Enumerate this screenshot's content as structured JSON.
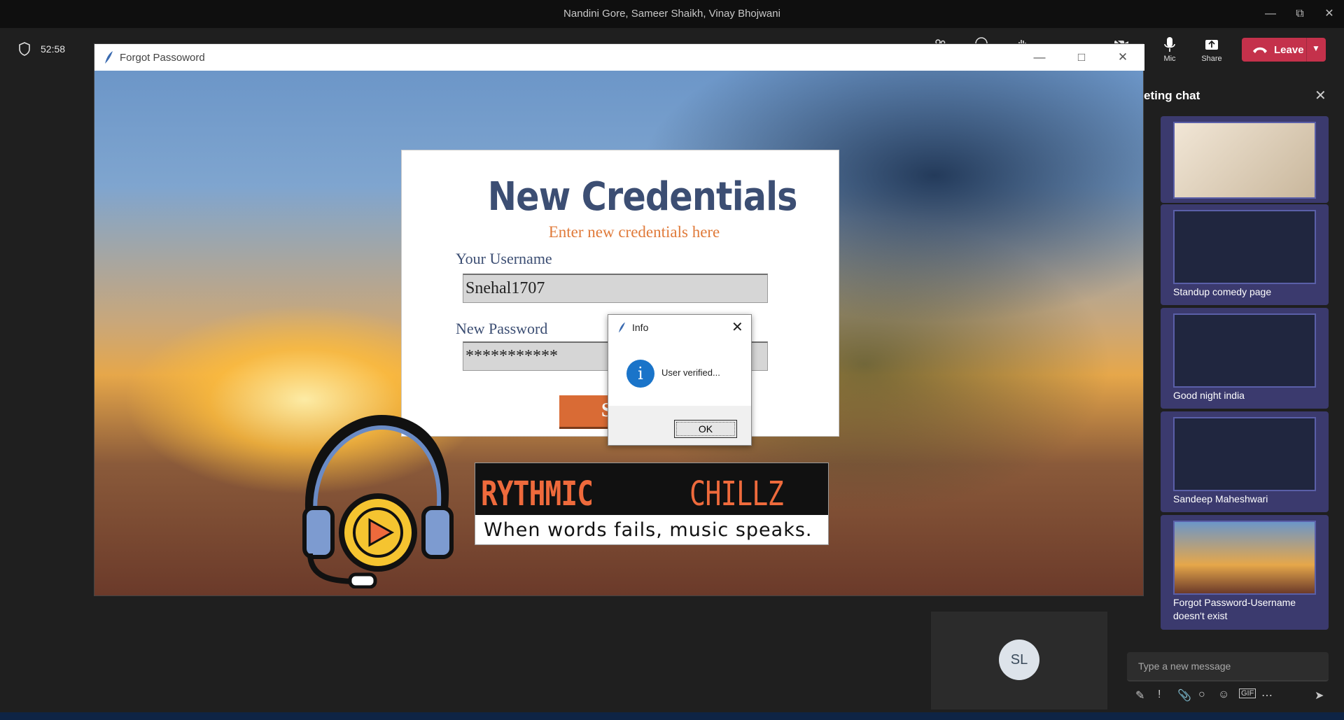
{
  "teams": {
    "window_title": "Nandini Gore, Sameer Shaikh, Vinay Bhojwani",
    "timer": "52:58",
    "mic_label": "Mic",
    "share_label": "Share",
    "leave_label": "Leave",
    "accent": "#c4314b"
  },
  "chat": {
    "title": "eting chat",
    "items": [
      {
        "caption": ""
      },
      {
        "caption": "Standup comedy page"
      },
      {
        "caption": "Good night india"
      },
      {
        "caption": "Sandeep Maheshwari"
      },
      {
        "caption": "Forgot Password-Username doesn't exist"
      }
    ],
    "compose_placeholder": "Type a new message"
  },
  "tile": {
    "initials": "SL"
  },
  "app": {
    "title": "Forgot Passoword",
    "heading": "New Credentials",
    "subheading": "Enter new credentials here",
    "username_label": "Your Username",
    "username_value": "Snehal1707",
    "password_label": "New Password",
    "password_value": "***********",
    "submit_label": "S",
    "brand_left": "RYTHMIC",
    "brand_right": "CHILLZ",
    "tagline": "When words fails, music speaks.",
    "accent": "#d96b35",
    "heading_color": "#3c4e73"
  },
  "dialog": {
    "title": "Info",
    "message": "User verified...",
    "ok_label": "OK"
  }
}
